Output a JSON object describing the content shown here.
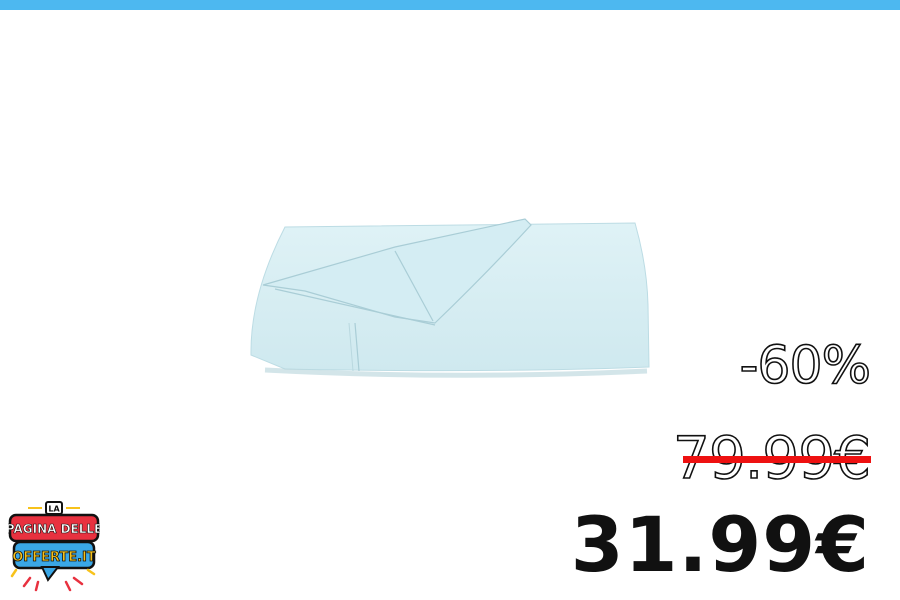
{
  "promo": {
    "discount": "-60%",
    "old_price": "79.99€",
    "new_price": "31.99€"
  },
  "logo": {
    "line1": "LA",
    "line2": "PAGINA DELLE",
    "line3": "OFFERTE.IT"
  },
  "colors": {
    "top_bar": "#4db8f0",
    "strike": "#ee1111",
    "logo_red": "#e8313f",
    "logo_blue": "#3aa7e6",
    "logo_yellow": "#f7c21b",
    "product": "#d6eef3"
  },
  "icons": {
    "logo": "pagina-delle-offerte-logo"
  }
}
